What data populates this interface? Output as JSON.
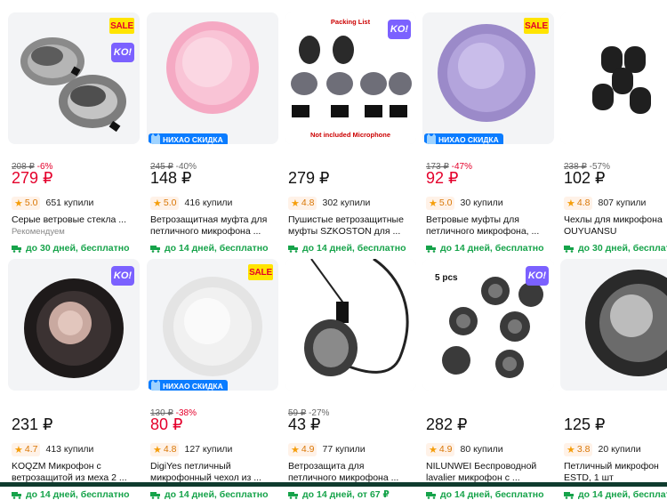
{
  "badges": {
    "sale": "SALE",
    "ko": "KO!",
    "nihao": "НИХАО СКИДКА"
  },
  "row1": [
    {
      "old_price": "208 ₽",
      "discount": "-6%",
      "price": "279 ₽",
      "price_red": true,
      "rating": "5.0",
      "bought": "651 купили",
      "title": "Серые ветровые стекла ...",
      "extra": "Рекомендуем",
      "delivery": "до 30 дней, бесплатно"
    },
    {
      "old_price": "245 ₽",
      "discount": "-40%",
      "price": "148 ₽",
      "price_red": false,
      "rating": "5.0",
      "bought": "416 купили",
      "title": "Ветрозащитная муфта для\nпетличного микрофона ...",
      "delivery": "до 14 дней, бесплатно"
    },
    {
      "old_price": "",
      "discount": "",
      "price": "279 ₽",
      "price_red": false,
      "rating": "4.8",
      "bought": "302 купили",
      "title": "Пушистые ветрозащитные\nмуфты SZKOSTON для ...",
      "delivery": "до 14 дней, бесплатно",
      "img_text_top": "Packing List",
      "img_text_bottom": "Not included Microphone"
    },
    {
      "old_price": "173 ₽",
      "discount": "-47%",
      "price": "92 ₽",
      "price_red": true,
      "rating": "5.0",
      "bought": "30 купили",
      "title": "Ветровые муфты для\nпетличного микрофона, ...",
      "delivery": "до 14 дней, бесплатно"
    },
    {
      "old_price": "238 ₽",
      "discount": "-57%",
      "price": "102 ₽",
      "price_red": false,
      "rating": "4.8",
      "bought": "807 купили",
      "title": "Чехлы для микрофона\nOUYUANSU",
      "delivery": "до 30 дней, бесплатно"
    }
  ],
  "row2": [
    {
      "old_price": "",
      "discount": "",
      "price": "231 ₽",
      "price_red": false,
      "rating": "4.7",
      "bought": "413 купили",
      "title": "KOQZM Микрофон с\nветрозащитой из меха 2 ...",
      "delivery": "до 14 дней, бесплатно"
    },
    {
      "old_price": "130 ₽",
      "discount": "-38%",
      "price": "80 ₽",
      "price_red": true,
      "rating": "4.8",
      "bought": "127 купили",
      "title": "DigiYes петличный\nмикрофонный чехол из ...",
      "delivery": "до 14 дней, бесплатно"
    },
    {
      "old_price": "59 ₽",
      "discount": "-27%",
      "price": "43 ₽",
      "price_red": false,
      "rating": "4.9",
      "bought": "77 купили",
      "title": "Ветрозащита для\nпетличного микрофона ...",
      "delivery": "до 14 дней, от 67 ₽"
    },
    {
      "old_price": "",
      "discount": "",
      "price": "282 ₽",
      "price_red": false,
      "rating": "4.9",
      "bought": "80 купили",
      "title": "NILUNWEI Беспроводной\nlavalier микрофон с ...",
      "delivery": "до 14 дней, бесплатно",
      "img_text_top": "5 pcs"
    },
    {
      "old_price": "",
      "discount": "",
      "price": "125 ₽",
      "price_red": false,
      "rating": "3.8",
      "bought": "20 купили",
      "title": "Петличный микрофон\nESTD, 1 шт",
      "delivery": "до 14 дней, бесплатно"
    }
  ]
}
